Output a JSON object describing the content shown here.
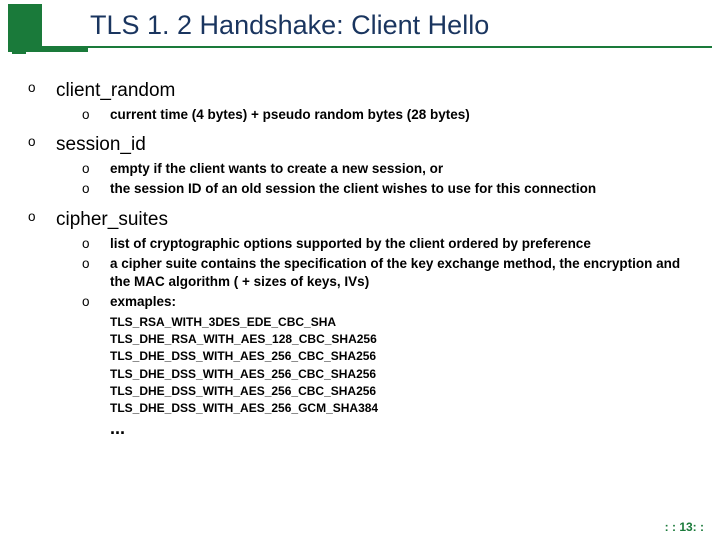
{
  "title": "TLS 1. 2 Handshake: Client Hello",
  "sections": [
    {
      "label": "client_random",
      "items": [
        "current time (4 bytes) + pseudo random bytes (28 bytes)"
      ]
    },
    {
      "label": "session_id",
      "items": [
        "empty if the client wants to create a new session, or",
        "the session ID of an old session the client wishes to use for this connection"
      ]
    },
    {
      "label": "cipher_suites",
      "items": [
        "list of cryptographic options supported by the client ordered by preference",
        "a cipher suite contains the specification of the key exchange method, the encryption and the MAC algorithm ( + sizes of keys, IVs)",
        "exmaples:"
      ]
    }
  ],
  "examples": [
    "TLS_RSA_WITH_3DES_EDE_CBC_SHA",
    "TLS_DHE_RSA_WITH_AES_128_CBC_SHA256",
    "TLS_DHE_DSS_WITH_AES_256_CBC_SHA256",
    "TLS_DHE_DSS_WITH_AES_256_CBC_SHA256",
    "TLS_DHE_DSS_WITH_AES_256_CBC_SHA256",
    "TLS_DHE_DSS_WITH_AES_256_GCM_SHA384"
  ],
  "ellipsis": "...",
  "pagenum": ": : 13: :"
}
